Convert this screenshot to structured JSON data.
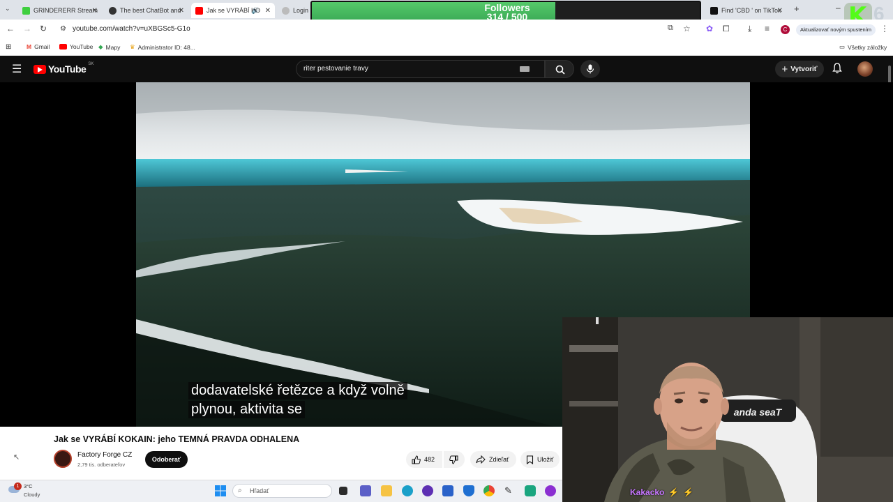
{
  "browser": {
    "tabs": [
      {
        "label": "GRINDERERR Stream",
        "color": "#3fcf3f",
        "active": false
      },
      {
        "label": "The best ChatBot and",
        "color": "#333333",
        "active": false
      },
      {
        "label": "Jak se VYRÁBÍ KO",
        "color": "#ff0000",
        "active": true
      },
      {
        "label": "Login",
        "color": "#888888",
        "active": false
      },
      {
        "label": "Find 'CBD ' on TikTok",
        "color": "#111111",
        "active": false
      }
    ],
    "url": "youtube.com/watch?v=uXBGSc5-G1o",
    "update_label": "Aktualizovať novým spustením",
    "profile_initial": "C",
    "bookmarks": [
      "Gmail",
      "YouTube",
      "Mapy",
      "Administrator ID: 48..."
    ],
    "all_bookmarks": "Všetky záložky"
  },
  "overlay": {
    "followers_title": "Followers",
    "followers_count": "314 / 500",
    "followers_progress": 0.628,
    "kick_number": "6"
  },
  "youtube": {
    "logo_text": "YouTube",
    "region": "SK",
    "search_value": "riter pestovanie travy",
    "create_label": "Vytvoriť"
  },
  "video": {
    "subtitle_line1": "dodavatelské řetězce a když volně",
    "subtitle_line2": "plynou, aktivita se",
    "title": "Jak se VYRÁBÍ KOKAIN: jeho TEMNÁ PRAVDA ODHALENA",
    "channel": "Factory Forge CZ",
    "subscribers": "2,79 tis. odberateľov",
    "subscribe_label": "Odoberať",
    "likes": "482",
    "share_label": "Zdieľať",
    "save_label": "Uložiť"
  },
  "stream": {
    "viewer_name": "Kakacko",
    "chair_brand": "anda seaT"
  },
  "taskbar": {
    "temperature": "3°C",
    "weather": "Cloudy",
    "notification_count": "1",
    "search_placeholder": "Hľadať"
  },
  "colors": {
    "yt_red": "#ff0000",
    "followers_fill": "#4bbf5f",
    "kick_green": "#53fc18"
  }
}
